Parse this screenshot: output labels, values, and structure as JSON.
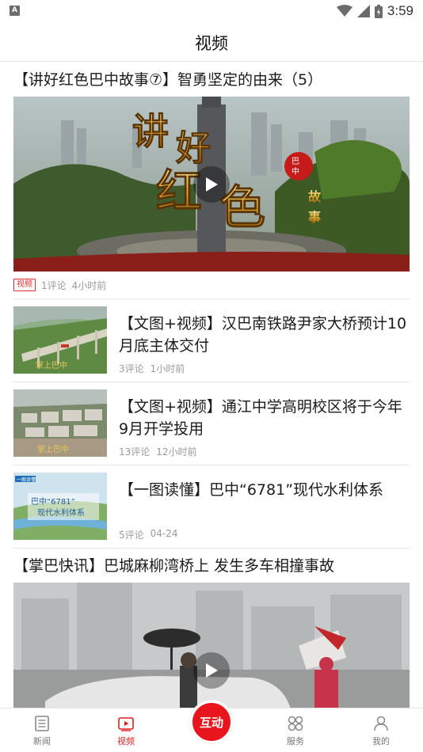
{
  "status_bar": {
    "left_icon": "A",
    "time": "3:59",
    "icons": [
      "wifi-icon",
      "signal-icon",
      "battery-icon"
    ]
  },
  "header": {
    "title": "视频"
  },
  "feed": {
    "featured": {
      "title": "【讲好红色巴中故事⑦】智勇坚定的由来（5）",
      "tag": "视频",
      "comments": "1评论",
      "time": "4小时前"
    },
    "items": [
      {
        "title": "【文图+视频】汉巴南铁路尹家大桥预计10月底主体交付",
        "comments": "3评论",
        "time": "1小时前"
      },
      {
        "title": "【文图+视频】通江中学高明校区将于今年9月开学投用",
        "comments": "13评论",
        "time": "12小时前"
      },
      {
        "title": "【一图读懂】巴中“6781”现代水利体系",
        "comments": "5评论",
        "time": "04-24"
      }
    ],
    "second_featured": {
      "title": "【掌巴快讯】巴城麻柳湾桥上 发生多车相撞事故"
    }
  },
  "tabbar": {
    "tabs": [
      {
        "label": "新闻",
        "icon": "newspaper-icon"
      },
      {
        "label": "视频",
        "icon": "video-icon"
      },
      {
        "label": "互动",
        "icon": ""
      },
      {
        "label": "服务",
        "icon": "grid-icon"
      },
      {
        "label": "我的",
        "icon": "person-icon"
      }
    ],
    "active_index": 1,
    "accent": "#e8161c"
  }
}
